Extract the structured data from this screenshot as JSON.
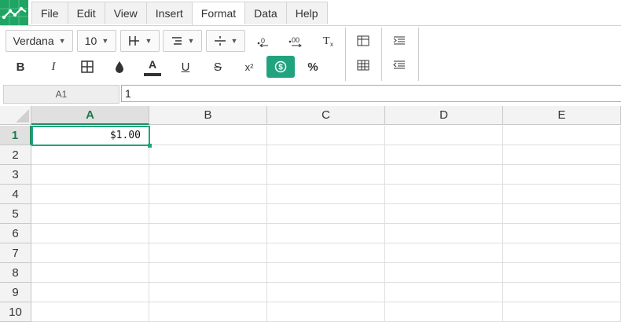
{
  "menu": {
    "tabs": [
      {
        "label": "File"
      },
      {
        "label": "Edit"
      },
      {
        "label": "View"
      },
      {
        "label": "Insert"
      },
      {
        "label": "Format",
        "active": true
      },
      {
        "label": "Data"
      },
      {
        "label": "Help"
      }
    ]
  },
  "toolbar": {
    "font_family": "Verdana",
    "font_size": "10",
    "bold": "B",
    "italic": "I",
    "font_color_label": "A",
    "underline": "U",
    "strikethrough": "S",
    "superscript": "x²",
    "percent": "%",
    "currency_active": true,
    "icons": [
      "borders-icon",
      "border-style-icon",
      "align-icon",
      "valign-icon",
      "decrease-decimal-icon",
      "increase-decimal-icon",
      "clear-format-icon",
      "bold-icon",
      "italic-icon",
      "fill-color-icon",
      "font-color-icon",
      "underline-icon",
      "strike-icon",
      "superscript-icon",
      "currency-icon",
      "percent-icon",
      "freeze-icon",
      "table-icon",
      "indent-icon",
      "outdent-icon"
    ]
  },
  "formula_bar": {
    "cell_ref": "A1",
    "value": "1"
  },
  "sheet": {
    "columns": [
      "A",
      "B",
      "C",
      "D",
      "E"
    ],
    "rows": [
      "1",
      "2",
      "3",
      "4",
      "5",
      "6",
      "7",
      "8",
      "9",
      "10"
    ],
    "selected_cell": "A1",
    "cells": {
      "A1": "$1.00"
    }
  },
  "colors": {
    "accent": "#22a37f",
    "logo": "#1fa463",
    "selected_header": "#1f7a4d"
  }
}
